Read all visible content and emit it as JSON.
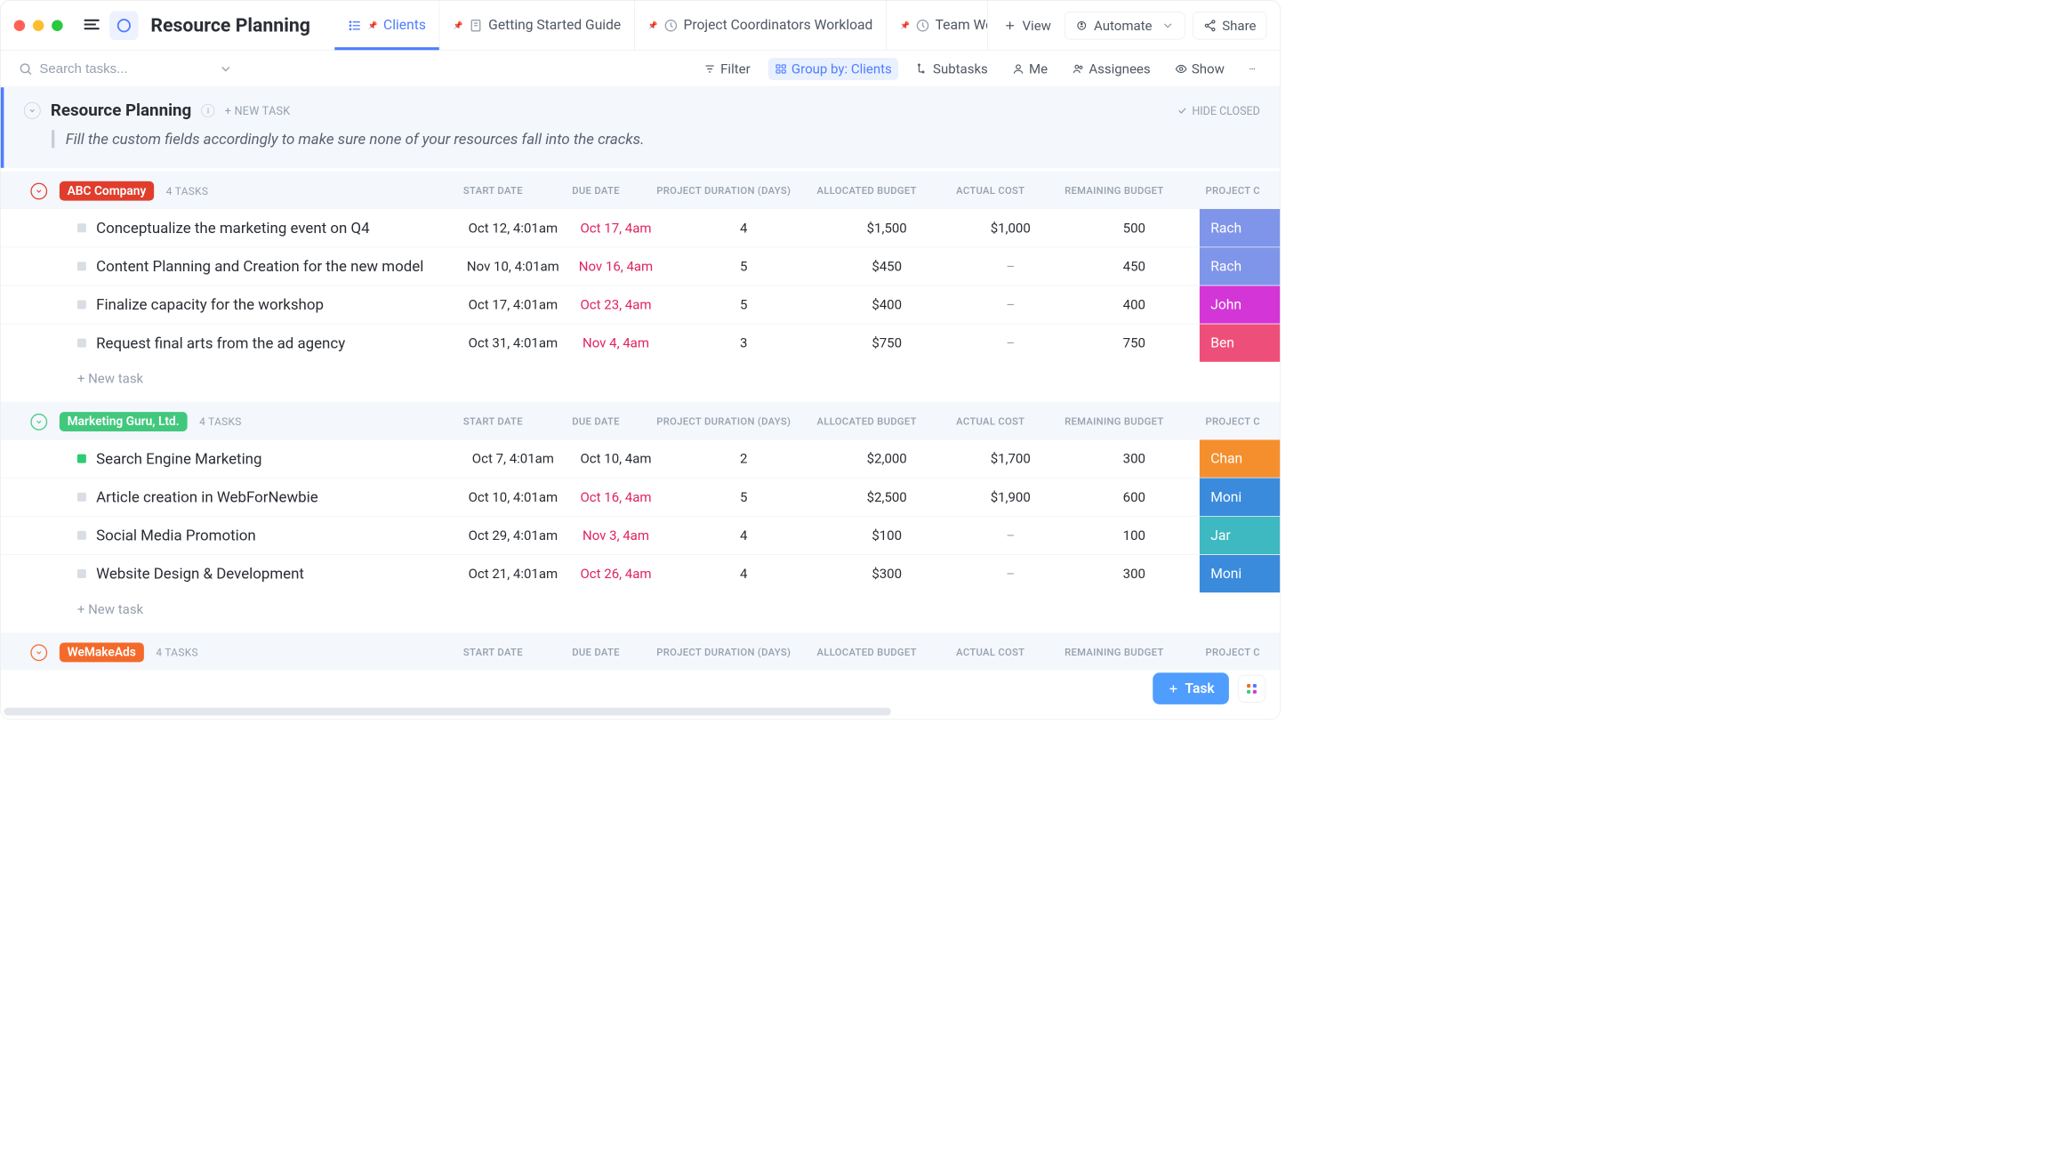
{
  "page_title": "Resource Planning",
  "tabs": [
    {
      "label": "Clients",
      "icon": "list",
      "active": true
    },
    {
      "label": "Getting Started Guide",
      "icon": "doc"
    },
    {
      "label": "Project Coordinators Workload",
      "icon": "workload"
    },
    {
      "label": "Team Workloa",
      "icon": "workload",
      "overflow": true
    }
  ],
  "view_label": "View",
  "automate_label": "Automate",
  "share_label": "Share",
  "search_placeholder": "Search tasks...",
  "toolbar": {
    "filter": "Filter",
    "group_by": "Group by: Clients",
    "subtasks": "Subtasks",
    "me": "Me",
    "assignees": "Assignees",
    "show": "Show"
  },
  "section": {
    "title": "Resource Planning",
    "new_task": "+ NEW TASK",
    "hide_closed": "HIDE CLOSED",
    "description": "Fill the custom fields accordingly to make sure none of your resources fall into the cracks."
  },
  "columns": {
    "start": "START DATE",
    "due": "DUE DATE",
    "duration": "PROJECT DURATION (DAYS)",
    "allocated": "ALLOCATED BUDGET",
    "actual": "ACTUAL COST",
    "remaining": "REMAINING BUDGET",
    "coordinator": "PROJECT C"
  },
  "new_task_row": "+ New task",
  "task_fab": "Task",
  "groups": [
    {
      "name": "ABC Company",
      "color": "#e03e2d",
      "count": "4 TASKS",
      "tasks": [
        {
          "name": "Conceptualize the marketing event on Q4",
          "start": "Oct 12, 4:01am",
          "due": "Oct 17, 4am",
          "overdue": true,
          "dur": "4",
          "alloc": "$1,500",
          "actual": "$1,000",
          "remain": "500",
          "coord": "Rach",
          "coord_bg": "#7f95e9"
        },
        {
          "name": "Content Planning and Creation for the new model",
          "start": "Nov 10, 4:01am",
          "due": "Nov 16, 4am",
          "overdue": true,
          "dur": "5",
          "alloc": "$450",
          "actual": "–",
          "remain": "450",
          "coord": "Rach",
          "coord_bg": "#7f95e9"
        },
        {
          "name": "Finalize capacity for the workshop",
          "start": "Oct 17, 4:01am",
          "due": "Oct 23, 4am",
          "overdue": true,
          "dur": "5",
          "alloc": "$400",
          "actual": "–",
          "remain": "400",
          "coord": "John",
          "coord_bg": "#d435d6"
        },
        {
          "name": "Request final arts from the ad agency",
          "start": "Oct 31, 4:01am",
          "due": "Nov 4, 4am",
          "overdue": true,
          "dur": "3",
          "alloc": "$750",
          "actual": "–",
          "remain": "750",
          "coord": "Ben",
          "coord_bg": "#ee4f7a"
        }
      ]
    },
    {
      "name": "Marketing Guru, Ltd.",
      "color": "#41c87d",
      "count": "4 TASKS",
      "tasks": [
        {
          "name": "Search Engine Marketing",
          "status": "done",
          "start": "Oct 7, 4:01am",
          "due": "Oct 10, 4am",
          "overdue": false,
          "dur": "2",
          "alloc": "$2,000",
          "actual": "$1,700",
          "remain": "300",
          "coord": "Chan",
          "coord_bg": "#f58f2e"
        },
        {
          "name": "Article creation in WebForNewbie",
          "start": "Oct 10, 4:01am",
          "due": "Oct 16, 4am",
          "overdue": true,
          "dur": "5",
          "alloc": "$2,500",
          "actual": "$1,900",
          "remain": "600",
          "coord": "Moni",
          "coord_bg": "#3b8bdd"
        },
        {
          "name": "Social Media Promotion",
          "start": "Oct 29, 4:01am",
          "due": "Nov 3, 4am",
          "overdue": true,
          "dur": "4",
          "alloc": "$100",
          "actual": "–",
          "remain": "100",
          "coord": "Jar",
          "coord_bg": "#3eb9c1"
        },
        {
          "name": "Website Design & Development",
          "start": "Oct 21, 4:01am",
          "due": "Oct 26, 4am",
          "overdue": true,
          "dur": "4",
          "alloc": "$300",
          "actual": "–",
          "remain": "300",
          "coord": "Moni",
          "coord_bg": "#3b8bdd"
        }
      ]
    },
    {
      "name": "WeMakeAds",
      "color": "#f46a2b",
      "count": "4 TASKS",
      "tasks": []
    }
  ]
}
